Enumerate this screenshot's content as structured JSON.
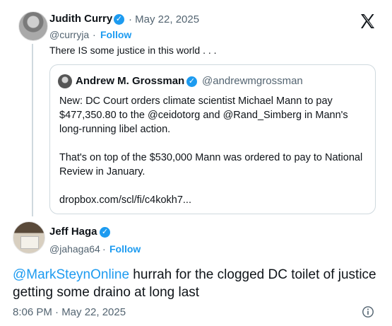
{
  "parent_tweet": {
    "name": "Judith Curry",
    "date": "May 22, 2025",
    "handle": "@curryja",
    "separator": "·",
    "follow_label": "Follow",
    "text": "There IS some justice in this world . . ."
  },
  "quoted_tweet": {
    "name": "Andrew M. Grossman",
    "handle": "@andrewmgrossman",
    "paragraph1": "New: DC Court orders climate scientist Michael Mann to pay $477,350.80 to the @ceidotorg and @Rand_Simberg  in Mann's long-running libel action.",
    "paragraph2": "That's on top of the $530,000 Mann was ordered to pay to National Review in January.",
    "link": "dropbox.com/scl/fi/c4kokh7..."
  },
  "main_tweet": {
    "name": "Jeff Haga",
    "handle": "@jahaga64",
    "separator": "·",
    "follow_label": "Follow",
    "mention": "@MarkSteynOnline",
    "text": " hurrah for the clogged DC toilet of justice getting some draino at long last",
    "timestamp": "8:06 PM · May 22, 2025"
  },
  "icons": {
    "verified": "verified-badge-icon",
    "platform": "x-logo-icon",
    "info": "info-icon"
  },
  "colors": {
    "accent": "#1d9bf0",
    "secondary_text": "#536471",
    "border": "#cfd9de"
  }
}
